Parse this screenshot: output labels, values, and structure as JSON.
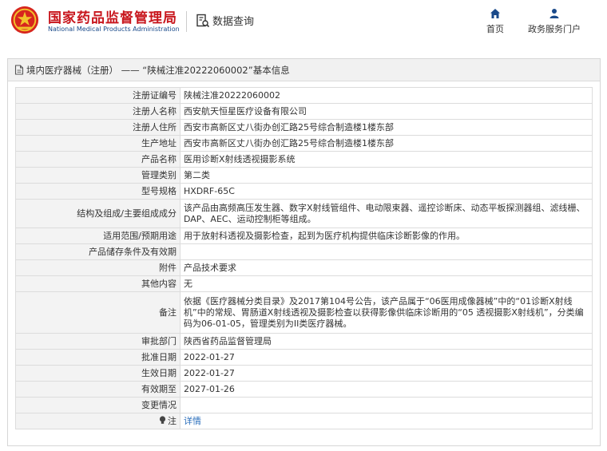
{
  "header": {
    "logo_icon": "national-emblem-icon",
    "title_cn": "国家药品监督管理局",
    "title_en": "National Medical Products Administration",
    "query_label": "数据查询",
    "query_icon": "document-search-icon",
    "nav": [
      {
        "label": "首页",
        "icon": "home-icon"
      },
      {
        "label": "政务服务门户",
        "icon": "user-icon"
      }
    ],
    "accent_color": "#c8161d",
    "nav_color": "#1a4a8a"
  },
  "panel": {
    "title": "境内医疗器械（注册） —— “陕械注准20222060002”基本信息",
    "title_icon": "document-icon"
  },
  "rows": [
    {
      "label": "注册证编号",
      "value": "陕械注准20222060002"
    },
    {
      "label": "注册人名称",
      "value": "西安航天恒星医疗设备有限公司"
    },
    {
      "label": "注册人住所",
      "value": "西安市高新区丈八街办创汇路25号综合制造楼1楼东部"
    },
    {
      "label": "生产地址",
      "value": "西安市高新区丈八街办创汇路25号综合制造楼1楼东部"
    },
    {
      "label": "产品名称",
      "value": "医用诊断X射线透视摄影系统"
    },
    {
      "label": "管理类别",
      "value": "第二类"
    },
    {
      "label": "型号规格",
      "value": "HXDRF-65C"
    },
    {
      "label": "结构及组成/主要组成成分",
      "value": "该产品由高频高压发生器、数字X射线管组件、电动限束器、遥控诊断床、动态平板探测器组、滤线栅、DAP、AEC、运动控制柜等组成。"
    },
    {
      "label": "适用范围/预期用途",
      "value": "用于放射科透视及摄影检查，起到为医疗机构提供临床诊断影像的作用。"
    },
    {
      "label": "产品储存条件及有效期",
      "value": ""
    },
    {
      "label": "附件",
      "value": "产品技术要求"
    },
    {
      "label": "其他内容",
      "value": "无"
    },
    {
      "label": "备注",
      "value": "依据《医疗器械分类目录》及2017第104号公告，该产品属于“06医用成像器械”中的“01诊断X射线机”中的常规、胃肠道X射线透视及摄影检查以获得影像供临床诊断用的“05 透视摄影X射线机”，分类编码为06-01-05，管理类别为II类医疗器械。"
    },
    {
      "label": "审批部门",
      "value": "陕西省药品监督管理局"
    },
    {
      "label": "批准日期",
      "value": "2022-01-27"
    },
    {
      "label": "生效日期",
      "value": "2022-01-27"
    },
    {
      "label": "有效期至",
      "value": "2027-01-26"
    },
    {
      "label": "变更情况",
      "value": ""
    }
  ],
  "note_row": {
    "label": "注",
    "icon": "lightbulb-icon",
    "link": "详情"
  }
}
